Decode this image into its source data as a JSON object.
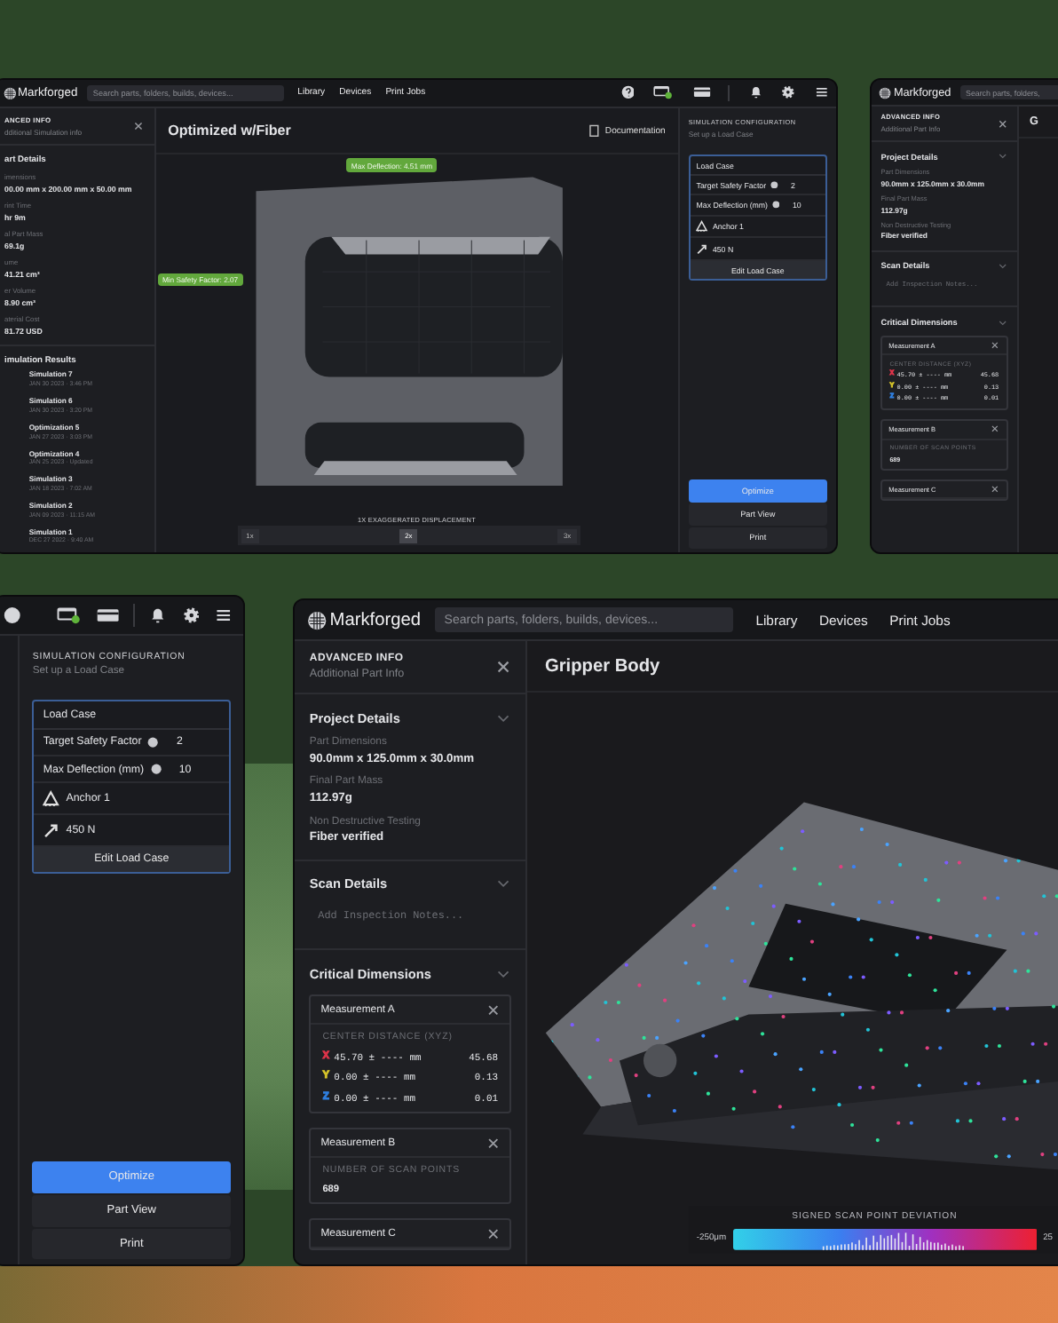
{
  "simulation_window": {
    "logo": "Markforged",
    "search": {
      "placeholder": "Search parts, folders, builds, devices..."
    },
    "nav": [
      {
        "label": "Library"
      },
      {
        "label": "Devices"
      },
      {
        "label": "Print Jobs"
      }
    ],
    "panel_header": {
      "title": "ANCED INFO",
      "subtitle": "dditional Simulation info"
    },
    "details": {
      "title": "art Details",
      "fields": [
        {
          "label": "imensions",
          "value": "00.00 mm x 200.00 mm x 50.00 mm"
        },
        {
          "label": "rint Time",
          "value": "hr 9m"
        },
        {
          "label": "al Part Mass",
          "value": "69.1g"
        },
        {
          "label": "ume",
          "value": "41.21 cm³"
        },
        {
          "label": "er Volume",
          "value": "8.90 cm³"
        },
        {
          "label": "aterial Cost",
          "value": "81.72 USD"
        }
      ]
    },
    "results": {
      "title": "imulation Results",
      "items": [
        {
          "name": "Simulation 7",
          "date": "JAN 30 2023 · 3:46 PM"
        },
        {
          "name": "Simulation 6",
          "date": "JAN 30 2023 · 3:20 PM"
        },
        {
          "name": "Optimization 5",
          "date": "JAN 27 2023 · 3:03 PM"
        },
        {
          "name": "Optimization 4",
          "date": "JAN 25 2023 · Updated"
        },
        {
          "name": "Simulation 3",
          "date": "JAN 18 2023 · 7:02 AM"
        },
        {
          "name": "Simulation 2",
          "date": "JAN 09 2023 · 11:15 AM"
        },
        {
          "name": "Simulation 1",
          "date": "DEC 27 2022 · 9:40 AM"
        }
      ]
    },
    "title": "Optimized w/Fiber",
    "doc_link": "Documentation",
    "callouts": [
      {
        "text": "Max Deflection: 4.51 mm"
      },
      {
        "text": "Min Safety Factor: 2.07"
      }
    ],
    "viewport_caption": "1X EXAGGERATED DISPLACEMENT",
    "zoom_buttons": [
      {
        "label": "1x",
        "selected": false
      },
      {
        "label": "2x",
        "selected": true
      },
      {
        "label": "3x",
        "selected": false
      }
    ],
    "config": {
      "heading": "SIMULATION CONFIGURATION",
      "subheading": "Set up a Load Case",
      "load_case": {
        "title": "Load Case",
        "params": [
          {
            "label": "Target Safety Factor",
            "value": "2"
          },
          {
            "label": "Max Deflection (mm)",
            "value": "10"
          }
        ],
        "items": [
          {
            "kind": "anchor",
            "label": "Anchor 1"
          },
          {
            "kind": "force",
            "label": "450 N"
          }
        ],
        "edit_button": "Edit Load Case"
      },
      "actions": [
        {
          "label": "Optimize",
          "kind": "primary"
        },
        {
          "label": "Part View",
          "kind": "secondary"
        },
        {
          "label": "Print",
          "kind": "secondary"
        }
      ]
    }
  },
  "part_window_small": {
    "logo": "Markforged",
    "search": {
      "placeholder": "Search parts, folders,"
    },
    "panel_header": {
      "title": "ADVANCED INFO",
      "subtitle": "Additional Part Info"
    },
    "title": "G",
    "project": {
      "title": "Project Details",
      "fields": [
        {
          "label": "Part Dimensions",
          "value": "90.0mm x 125.0mm x 30.0mm"
        },
        {
          "label": "Final Part Mass",
          "value": "112.97g"
        },
        {
          "label": "Non Destructive Testing",
          "value": "Fiber verified"
        }
      ]
    },
    "scan": {
      "title": "Scan Details",
      "notes_placeholder": "Add Inspection Notes..."
    },
    "critical": {
      "title": "Critical Dimensions",
      "measurements": [
        {
          "kind": "xyz",
          "name": "Measurement A",
          "label": "CENTER DISTANCE (XYZ)",
          "rows": [
            {
              "axis": "X",
              "color": "#e0344a",
              "nominal": "45.70 ± ---- mm",
              "measured": "45.68"
            },
            {
              "axis": "Y",
              "color": "#d6c42a",
              "nominal": "0.00 ± ---- mm",
              "measured": "0.13"
            },
            {
              "axis": "Z",
              "color": "#2f7fe0",
              "nominal": "0.00 ± ---- mm",
              "measured": "0.01"
            }
          ]
        },
        {
          "kind": "count",
          "name": "Measurement B",
          "label": "NUMBER OF SCAN POINTS",
          "value": "689"
        },
        {
          "kind": "collapsed",
          "name": "Measurement C"
        }
      ]
    }
  },
  "config_window": {
    "config": {
      "heading": "SIMULATION CONFIGURATION",
      "subheading": "Set up a Load Case",
      "load_case": {
        "title": "Load Case",
        "params": [
          {
            "label": "Target Safety Factor",
            "value": "2"
          },
          {
            "label": "Max Deflection (mm)",
            "value": "10"
          }
        ],
        "items": [
          {
            "kind": "anchor",
            "label": "Anchor 1"
          },
          {
            "kind": "force",
            "label": "450 N"
          }
        ],
        "edit_button": "Edit Load Case"
      },
      "actions": [
        {
          "label": "Optimize",
          "kind": "primary"
        },
        {
          "label": "Part View",
          "kind": "secondary"
        },
        {
          "label": "Print",
          "kind": "secondary"
        }
      ]
    }
  },
  "part_window": {
    "logo": "Markforged",
    "search": {
      "placeholder": "Search parts, folders, builds, devices..."
    },
    "nav": [
      {
        "label": "Library"
      },
      {
        "label": "Devices"
      },
      {
        "label": "Print Jobs"
      }
    ],
    "panel_header": {
      "title": "ADVANCED INFO",
      "subtitle": "Additional Part Info"
    },
    "title": "Gripper Body",
    "project": {
      "title": "Project Details",
      "fields": [
        {
          "label": "Part Dimensions",
          "value": "90.0mm x 125.0mm x 30.0mm"
        },
        {
          "label": "Final Part Mass",
          "value": "112.97g"
        },
        {
          "label": "Non Destructive Testing",
          "value": "Fiber verified"
        }
      ]
    },
    "scan": {
      "title": "Scan Details",
      "notes_placeholder": "Add Inspection Notes..."
    },
    "critical": {
      "title": "Critical Dimensions",
      "measurements": [
        {
          "kind": "xyz",
          "name": "Measurement A",
          "label": "CENTER DISTANCE (XYZ)",
          "rows": [
            {
              "axis": "X",
              "color": "#e0344a",
              "nominal": "45.70 ± ---- mm",
              "measured": "45.68"
            },
            {
              "axis": "Y",
              "color": "#d6c42a",
              "nominal": "0.00 ± ---- mm",
              "measured": "0.13"
            },
            {
              "axis": "Z",
              "color": "#2f7fe0",
              "nominal": "0.00 ± ---- mm",
              "measured": "0.01"
            }
          ]
        },
        {
          "kind": "count",
          "name": "Measurement B",
          "label": "NUMBER OF SCAN POINTS",
          "value": "689"
        },
        {
          "kind": "collapsed",
          "name": "Measurement C"
        }
      ]
    },
    "legend": {
      "title": "SIGNED SCAN POINT DEVIATION",
      "min": "-250μm",
      "max": "25"
    }
  }
}
